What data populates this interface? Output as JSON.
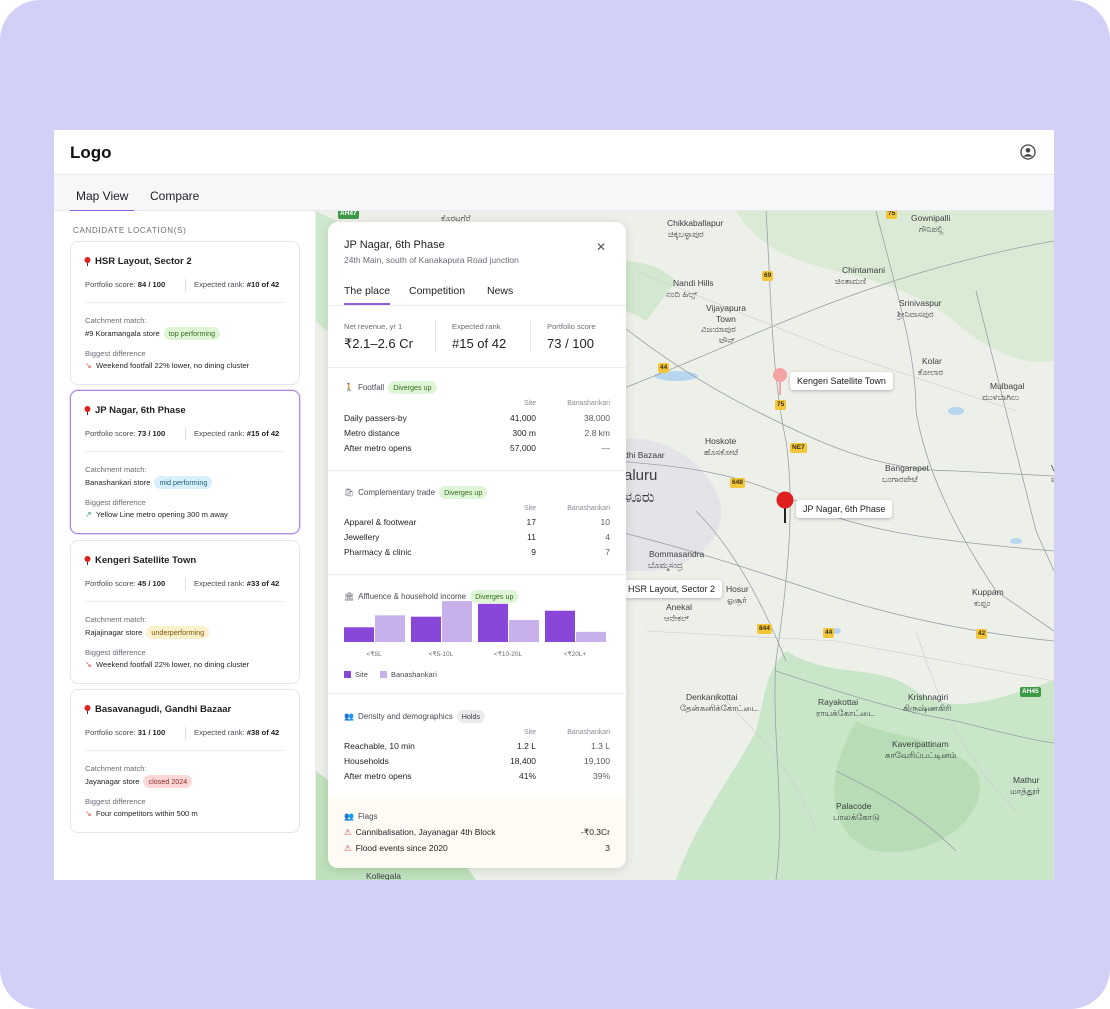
{
  "app": {
    "logo": "Logo"
  },
  "tabs": [
    {
      "label": "Map View",
      "active": true
    },
    {
      "label": "Compare",
      "active": false
    }
  ],
  "sidebar": {
    "title": "CANDIDATE LOCATION(S)",
    "portfolio_label": "Portfolio score:",
    "rank_label": "Expected rank:",
    "catchment_label": "Catchment match:",
    "difference_label": "Biggest difference",
    "cards": [
      {
        "name": "HSR Layout, Sector 2",
        "score": "84 / 100",
        "rank": "#10 of 42",
        "store": "#9 Koramangala store",
        "pill": "top performing",
        "pill_color": "green",
        "difference": "Weekend footfall 22% lower, no dining cluster",
        "trend": "down"
      },
      {
        "name": "JP Nagar, 6th Phase",
        "score": "73 / 100",
        "rank": "#15 of 42",
        "store": "Banashankari store",
        "pill": "mid performing",
        "pill_color": "blue",
        "difference": "Yellow Line metro opening 300 m away",
        "trend": "up"
      },
      {
        "name": "Kengeri Satellite Town",
        "score": "45 / 100",
        "rank": "#33 of 42",
        "store": "Rajajinagar store",
        "pill": "underperforming",
        "pill_color": "yellow",
        "difference": "Weekend footfall 22% lower, no dining cluster",
        "trend": "down"
      },
      {
        "name": "Basavanagudi, Gandhi Bazaar",
        "score": "31 / 100",
        "rank": "#38 of 42",
        "store": "Jayanagar store",
        "pill": "closed 2024",
        "pill_color": "red",
        "difference": "Four competitors within 500 m",
        "trend": "down"
      }
    ]
  },
  "map": {
    "labels": [
      "Gownipalli",
      "ಗೌನಿಪಲ್ಲಿ",
      "Chikkaballapur",
      "ಚಿಕ್ಕಬಳ್ಳಾಪುರ",
      "Chintamani",
      "ಚಿಂತಾಮಣಿ",
      "Nandi Hills",
      "ನಂದಿ ಹಿಲ್ಸ್",
      "Vijayapura",
      "Town",
      "ವಿಜಯಾಪುರ",
      "ಟೌನ್",
      "Srinivaspur",
      "ಶ್ರೀನಿವಾಸಪುರ",
      "Kolar",
      "ಕೋಲಾರ",
      "Mulbagal",
      "ಮುಳಬಾಗಿಲು",
      "Hoskote",
      "ಹೊಸಕೋಟೆ",
      "Bangarapet",
      "ಬಂಗಾರಪೇಟೆ",
      "Venkat",
      "ವೆಂಕಟ",
      "dhi Bazaar",
      "aluru",
      "ಳೂರು",
      "Bommasandra",
      "ಬೊಮ್ಮಸಂದ್ರ",
      "Hosur",
      "ஓசூர்",
      "Anekal",
      "ಆನೇಕಲ್",
      "Kuppam",
      "ಕುಪ್ಪಂ",
      "Krishnagiri",
      "கிருஷ்ணகிரி",
      "Denkanikottai",
      "தேன்கனிக்கோட்டை",
      "Rayakottai",
      "ராயக்கோட்டை",
      "Kaveripattinam",
      "காவேரிப்பட்டினம்",
      "Mathur",
      "மாத்தூர்",
      "Palacode",
      "பாலக்கோடு",
      "Kollegala",
      "ಕೊರಟಗೆರೆ"
    ],
    "shields": [
      "AH47",
      "69",
      "44",
      "75",
      "NE7",
      "648",
      "844",
      "44",
      "42",
      "AH45",
      "75"
    ],
    "markers": [
      {
        "label": "Kengeri Satellite Town",
        "status": "other"
      },
      {
        "label": "JP Nagar, 6th Phase",
        "status": "selected"
      },
      {
        "label": "HSR Layout, Sector 2",
        "status": "other"
      }
    ]
  },
  "panel": {
    "title": "JP Nagar, 6th Phase",
    "subtitle": "24th Main, south of Kanakapura Road junction",
    "tabs": [
      "The place",
      "Competition",
      "News"
    ],
    "kpis": [
      {
        "label": "Net revenue, yr 1",
        "value": "₹2.1–2.6 Cr"
      },
      {
        "label": "Expected rank",
        "value": "#15 of 42"
      },
      {
        "label": "Portfolio score",
        "value": "73 / 100"
      }
    ],
    "col_site": "Site",
    "col_compare": "Banashankari",
    "footfall": {
      "title": "Footfall",
      "badge": "Diverges up",
      "rows": [
        {
          "label": "Daily passers-by",
          "site": "41,000",
          "compare": "38,000"
        },
        {
          "label": "Metro distance",
          "site": "300 m",
          "compare": "2.8 km"
        },
        {
          "label": "After metro opens",
          "site": "57,000",
          "compare": "—"
        }
      ]
    },
    "trade": {
      "title": "Complementary trade",
      "badge": "Diverges up",
      "rows": [
        {
          "label": "Apparel & footwear",
          "site": "17",
          "compare": "10"
        },
        {
          "label": "Jewellery",
          "site": "11",
          "compare": "4"
        },
        {
          "label": "Pharmacy & clinic",
          "site": "9",
          "compare": "7"
        }
      ]
    },
    "affluence": {
      "title": "Affluence & household income",
      "badge": "Diverges up"
    },
    "density": {
      "title": "Density and demographics",
      "badge": "Holds",
      "rows": [
        {
          "label": "Reachable, 10 min",
          "site": "1.2 L",
          "compare": "1.3 L"
        },
        {
          "label": "Households",
          "site": "18,400",
          "compare": "19,100"
        },
        {
          "label": "After metro opens",
          "site": "41%",
          "compare": "39%"
        }
      ]
    },
    "flags": {
      "title": "Flags",
      "rows": [
        {
          "label": "Cannibalisation, Jayanagar 4th Block",
          "value": "-₹0.3Cr"
        },
        {
          "label": "Flood events since 2020",
          "value": "3"
        }
      ]
    }
  },
  "chart_data": {
    "type": "bar",
    "categories": [
      "<₹5L",
      "<₹5-10L",
      "<₹10-20L",
      "<₹20L+"
    ],
    "series": [
      {
        "name": "Site",
        "values": [
          0.32,
          0.55,
          0.83,
          0.68
        ],
        "color": "#8847d8"
      },
      {
        "name": "Banashankari",
        "values": [
          0.58,
          0.89,
          0.48,
          0.22
        ],
        "color": "#c8b1ea"
      }
    ],
    "ylim": [
      0,
      1
    ],
    "legend": "bottom-left",
    "grid": false
  },
  "colors": {
    "accent": "#8b5fd6",
    "marker": "#e02020",
    "marker_other": "#f28c8c"
  }
}
